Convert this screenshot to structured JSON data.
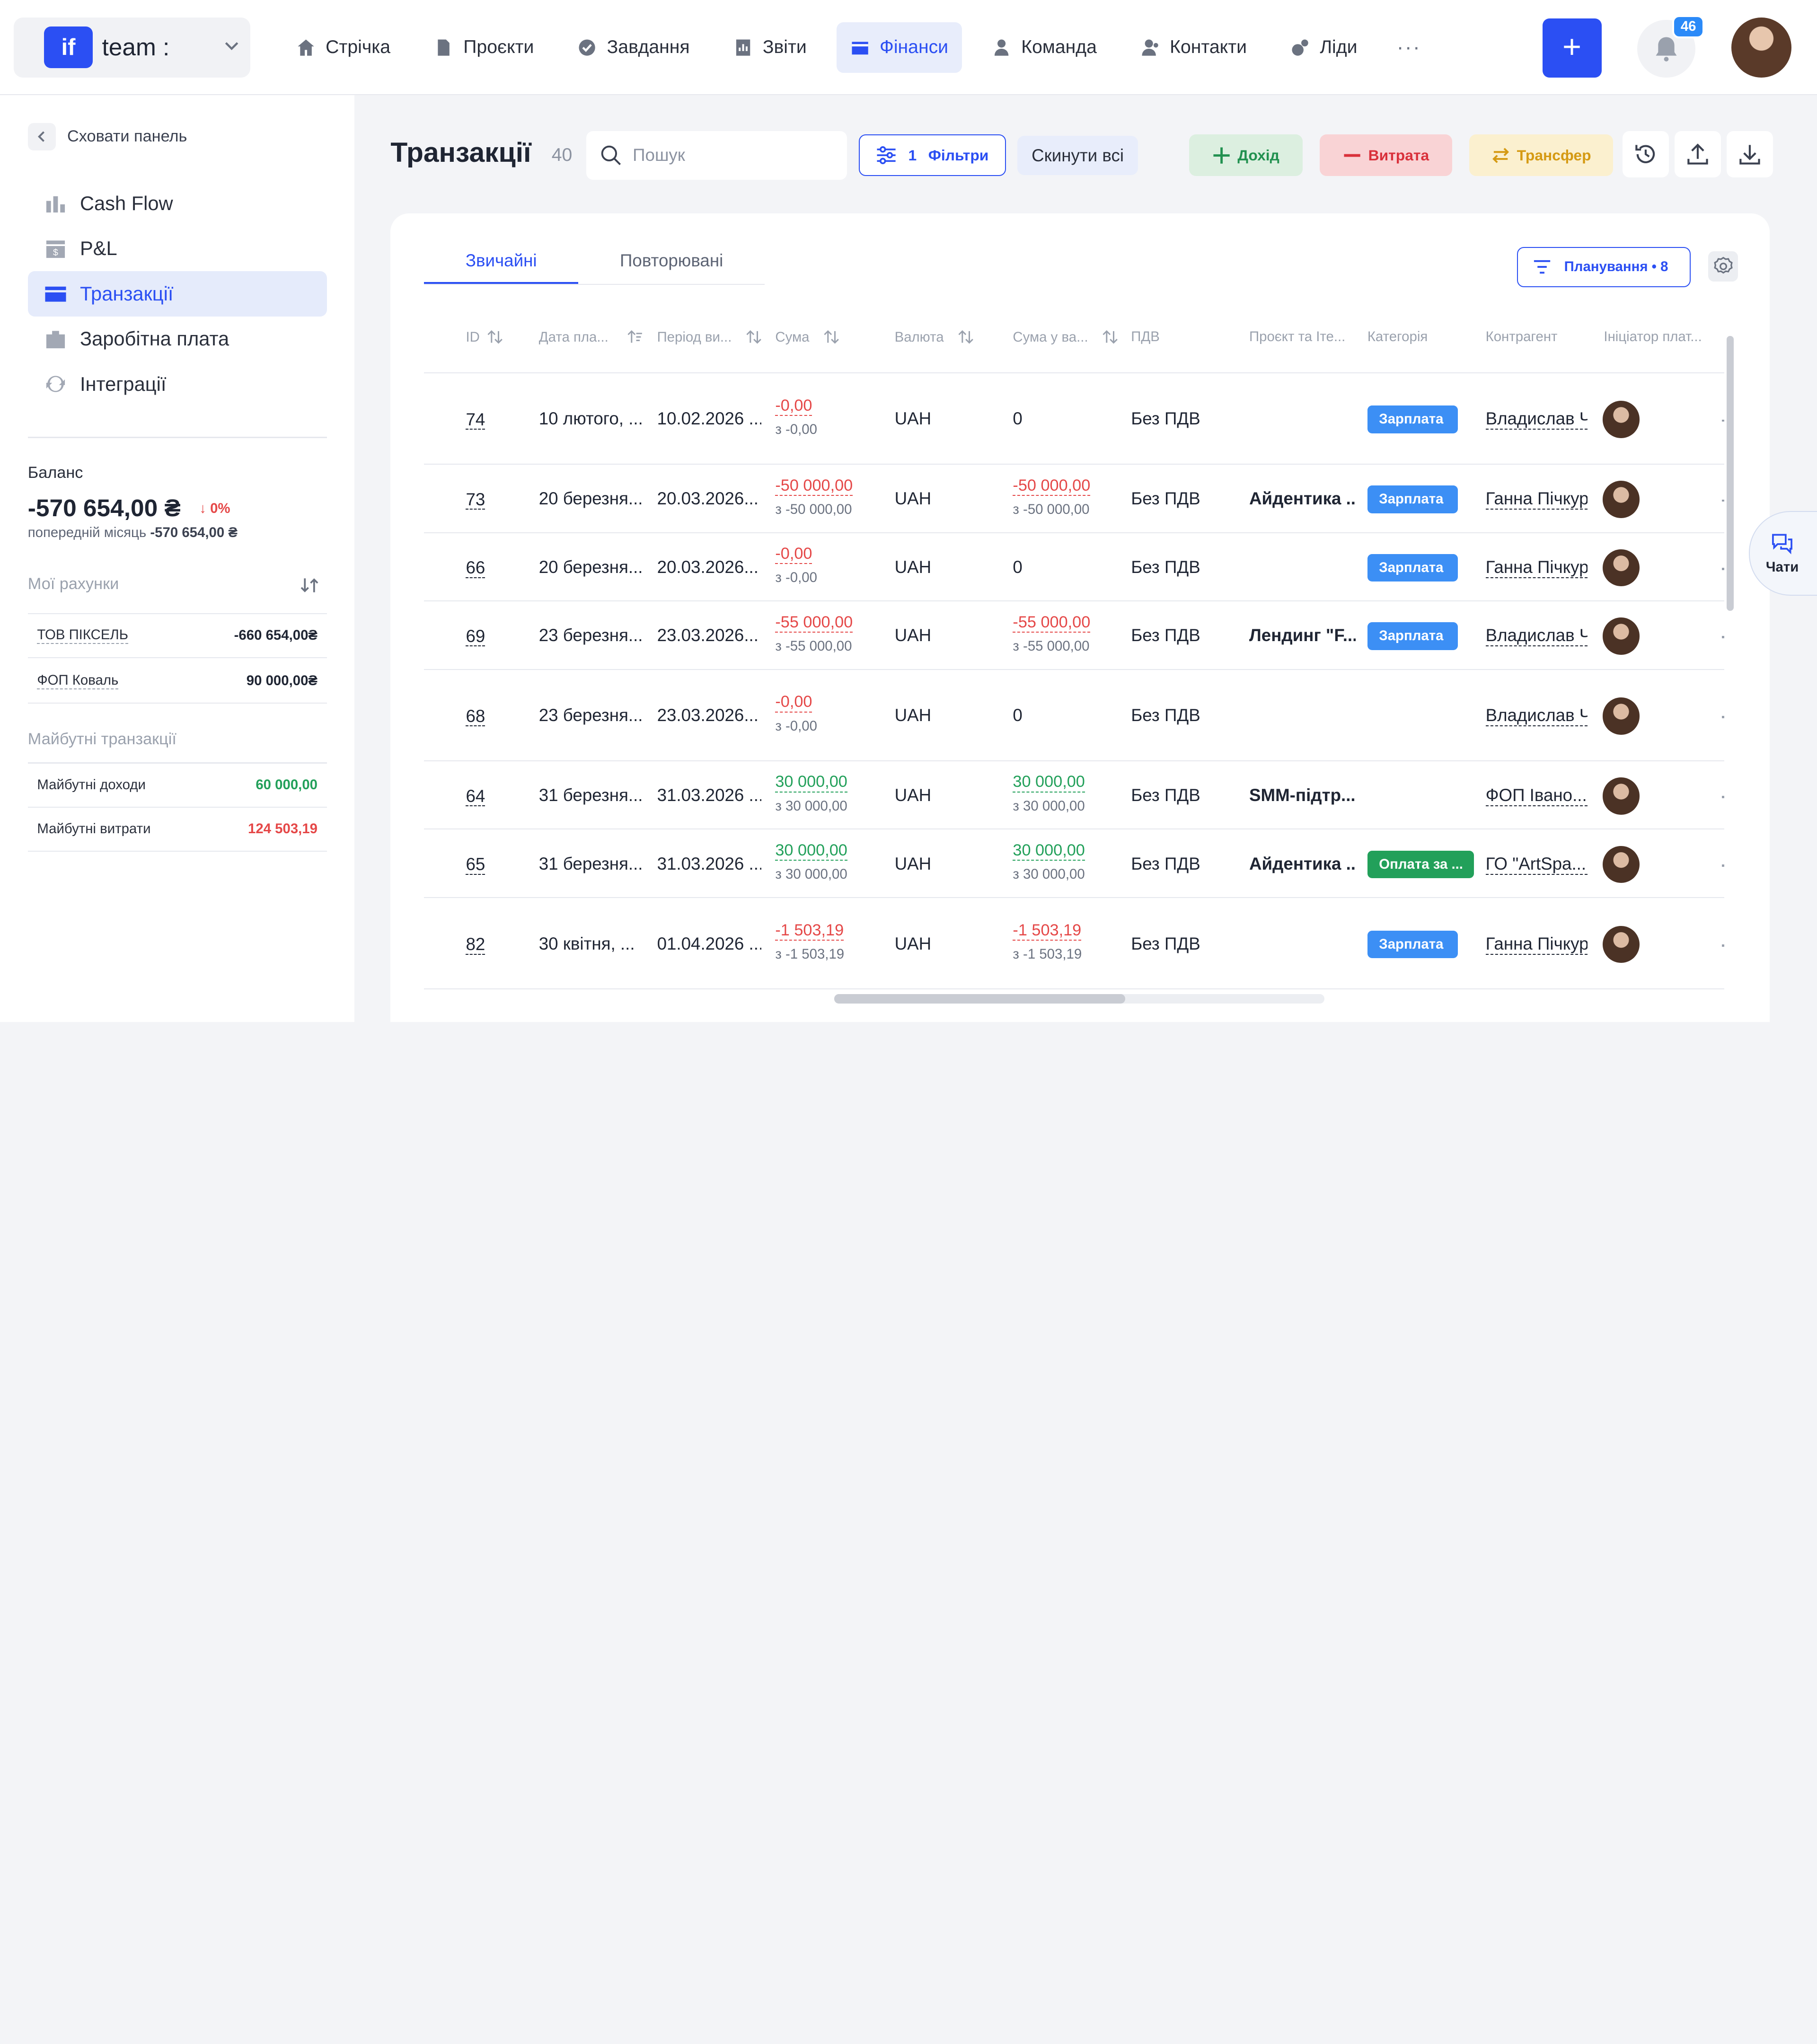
{
  "workspace": {
    "logo": "if",
    "name": "team :"
  },
  "nav": [
    {
      "label": "Стрічка",
      "icon": "home-icon"
    },
    {
      "label": "Проєкти",
      "icon": "document-icon"
    },
    {
      "label": "Завдання",
      "icon": "check-circle-icon"
    },
    {
      "label": "Звіти",
      "icon": "report-icon"
    },
    {
      "label": "Фінанси",
      "icon": "wallet-icon",
      "active": true
    },
    {
      "label": "Команда",
      "icon": "person-icon"
    },
    {
      "label": "Контакти",
      "icon": "contacts-icon"
    },
    {
      "label": "Ліди",
      "icon": "leads-icon"
    }
  ],
  "nav_more": "···",
  "header": {
    "add_label": "+",
    "notifications_count": "46"
  },
  "sidebar": {
    "hide_label": "Сховати панель",
    "items": [
      {
        "label": "Cash Flow",
        "icon": "cashflow-icon"
      },
      {
        "label": "P&L",
        "icon": "pl-icon"
      },
      {
        "label": "Транзакції",
        "icon": "card-icon",
        "active": true
      },
      {
        "label": "Заробітна плата",
        "icon": "salary-icon"
      },
      {
        "label": "Інтеграції",
        "icon": "sync-icon"
      }
    ],
    "balance": {
      "label": "Баланс",
      "value": "-570 654,00 ₴",
      "delta": "0%",
      "prev_label": "попередній місяць",
      "prev_value": "-570 654,00 ₴"
    },
    "accounts_title": "Мої рахунки",
    "accounts": [
      {
        "name": "ТОВ ПІКСЕЛЬ",
        "value": "-660 654,00₴"
      },
      {
        "name": "ФОП Коваль",
        "value": "90 000,00₴"
      }
    ],
    "future_title": "Майбутні транзакції",
    "future": [
      {
        "name": "Майбутні доходи",
        "value": "60 000,00",
        "color": "#22a05a"
      },
      {
        "name": "Майбутні витрати",
        "value": "124 503,19",
        "color": "#e54848"
      }
    ]
  },
  "page": {
    "title": "Транзакції",
    "count": "40",
    "search_placeholder": "Пошук",
    "filters_count": "1",
    "filters_label": "Фільтри",
    "reset_label": "Скинути всі",
    "income_label": "Дохід",
    "expense_label": "Витрата",
    "transfer_label": "Трансфер"
  },
  "tabs": [
    {
      "label": "Звичайні",
      "active": true
    },
    {
      "label": "Повторювані"
    }
  ],
  "planning_label": "Планування • 8",
  "columns": [
    "ID",
    "Дата пла...",
    "Період ви...",
    "Сума",
    "Валюта",
    "Сума у ва...",
    "ПДВ",
    "Проєкт та Іте...",
    "Категорія",
    "Контрагент",
    "Ініціатор плат..."
  ],
  "rows": [
    {
      "id": "74",
      "date": "10 лютого, ...",
      "period": "10.02.2026 ...",
      "amount": "-0,00",
      "amount_sub": "з -0,00",
      "currency": "UAH",
      "amount_cur": "0",
      "amount_cur_sub": "",
      "vat": "Без ПДВ",
      "project": "",
      "category": "Зарплата",
      "counterparty": "Владислав Ч"
    },
    {
      "id": "73",
      "date": "20 березня...",
      "period": "20.03.2026...",
      "amount": "-50 000,00",
      "amount_sub": "з -50 000,00",
      "currency": "UAH",
      "amount_cur": "-50 000,00",
      "amount_cur_sub": "з -50 000,00",
      "vat": "Без ПДВ",
      "project": "Айдентика ...",
      "category": "Зарплата",
      "counterparty": "Ганна Пічкур"
    },
    {
      "id": "66",
      "date": "20 березня...",
      "period": "20.03.2026...",
      "amount": "-0,00",
      "amount_sub": "з -0,00",
      "currency": "UAH",
      "amount_cur": "0",
      "amount_cur_sub": "",
      "vat": "Без ПДВ",
      "project": "",
      "category": "Зарплата",
      "counterparty": "Ганна Пічкур"
    },
    {
      "id": "69",
      "date": "23 березня...",
      "period": "23.03.2026...",
      "amount": "-55 000,00",
      "amount_sub": "з -55 000,00",
      "currency": "UAH",
      "amount_cur": "-55 000,00",
      "amount_cur_sub": "з -55 000,00",
      "vat": "Без ПДВ",
      "project": "Лендинг \"F...",
      "category": "Зарплата",
      "counterparty": "Владислав Ч"
    },
    {
      "id": "68",
      "date": "23 березня...",
      "period": "23.03.2026...",
      "amount": "-0,00",
      "amount_sub": "з -0,00",
      "currency": "UAH",
      "amount_cur": "0",
      "amount_cur_sub": "",
      "vat": "Без ПДВ",
      "project": "",
      "category": "",
      "counterparty": "Владислав Ч"
    },
    {
      "id": "64",
      "date": "31 березня...",
      "period": "31.03.2026 ...",
      "amount": "30 000,00",
      "amount_sub": "з 30 000,00",
      "currency": "UAH",
      "amount_cur": "30 000,00",
      "amount_cur_sub": "з 30 000,00",
      "vat": "Без ПДВ",
      "project": "SMM-підтр...",
      "category": "",
      "counterparty": "ФОП Івано..."
    },
    {
      "id": "65",
      "date": "31 березня...",
      "period": "31.03.2026 ...",
      "amount": "30 000,00",
      "amount_sub": "з 30 000,00",
      "currency": "UAH",
      "amount_cur": "30 000,00",
      "amount_cur_sub": "з 30 000,00",
      "vat": "Без ПДВ",
      "project": "Айдентика ...",
      "category": "Оплата за ...",
      "counterparty": "ГО \"ArtSpa..."
    },
    {
      "id": "82",
      "date": "30 квітня, ...",
      "period": "01.04.2026 ...",
      "amount": "-1 503,19",
      "amount_sub": "з -1 503,19",
      "currency": "UAH",
      "amount_cur": "-1 503,19",
      "amount_cur_sub": "з -1 503,19",
      "vat": "Без ПДВ",
      "project": "",
      "category": "Зарплата",
      "counterparty": "Ганна Пічкур"
    }
  ],
  "chat_label": "Чати",
  "colors": {
    "accent": "#2b4ff3",
    "negative": "#e54848",
    "positive": "#22a05a",
    "category_blue": "#3c8ff5",
    "category_green": "#22a05a"
  }
}
